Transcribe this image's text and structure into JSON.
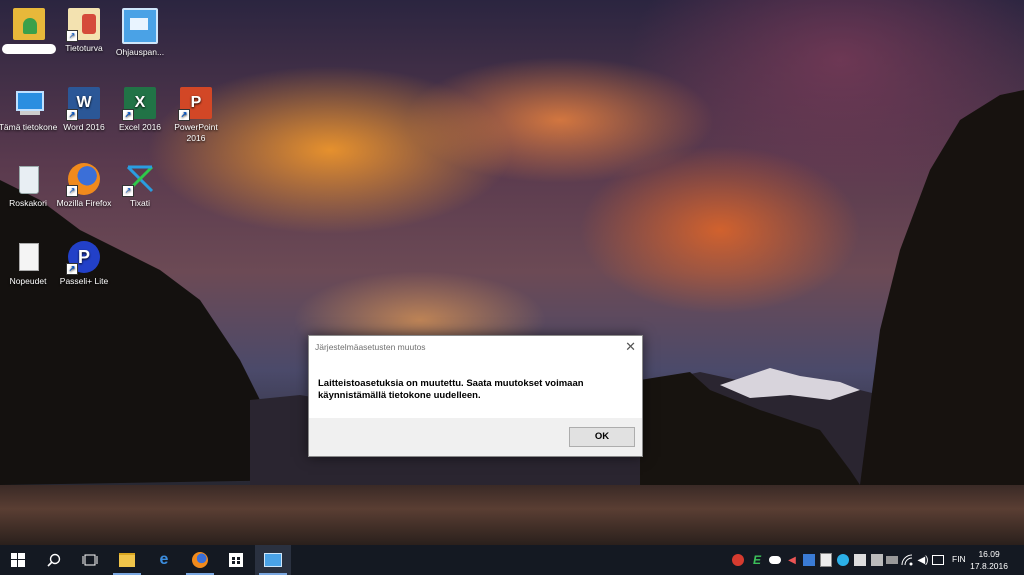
{
  "desktop": {
    "icons": [
      {
        "label": "",
        "icon": "user-folder-icon"
      },
      {
        "label": "Tietoturva",
        "icon": "security-icon"
      },
      {
        "label": "Ohjauspan...",
        "icon": "control-panel-icon"
      },
      {
        "label": "Tämä tietokone",
        "icon": "computer-icon"
      },
      {
        "label": "Word 2016",
        "icon": "word-icon"
      },
      {
        "label": "Excel 2016",
        "icon": "excel-icon"
      },
      {
        "label": "PowerPoint 2016",
        "icon": "powerpoint-icon"
      },
      {
        "label": "Roskakori",
        "icon": "recycle-bin-icon"
      },
      {
        "label": "Mozilla Firefox",
        "icon": "firefox-icon"
      },
      {
        "label": "Tixati",
        "icon": "tixati-icon"
      },
      {
        "label": "Nopeudet",
        "icon": "document-icon"
      },
      {
        "label": "Passeli+ Lite",
        "icon": "passeli-icon"
      }
    ]
  },
  "dialog": {
    "title": "Järjestelmäasetusten muutos",
    "message": "Laitteistoasetuksia on muutettu. Saata muutokset voimaan käynnistämällä tietokone uudelleen.",
    "ok_label": "OK",
    "close_glyph": "✕"
  },
  "taskbar": {
    "language": "FIN",
    "time": "16.09",
    "date": "17.8.2016",
    "accent": "#7aa7e0"
  }
}
